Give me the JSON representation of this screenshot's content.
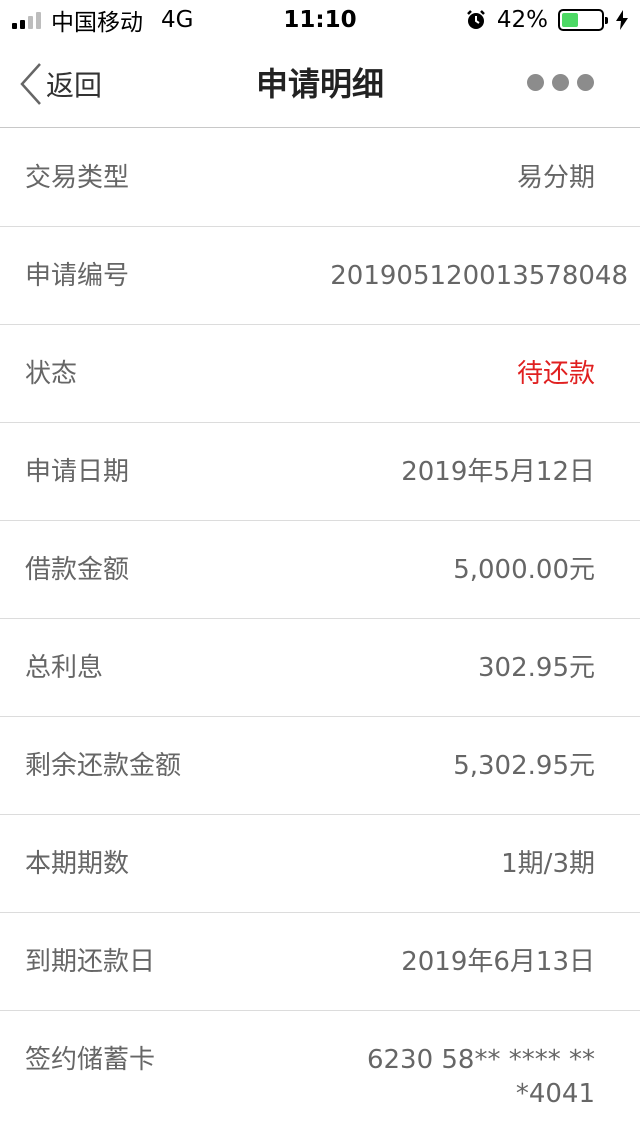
{
  "status_bar": {
    "carrier": "中国移动",
    "network": "4G",
    "time": "11:10",
    "battery_percent": "42%",
    "battery_level": 0.42,
    "battery_color": "#4cd964"
  },
  "nav": {
    "back_label": "返回",
    "title": "申请明细"
  },
  "details": [
    {
      "label": "交易类型",
      "value": "易分期"
    },
    {
      "label": "申请编号",
      "value": "201905120013578048"
    },
    {
      "label": "状态",
      "value": "待还款",
      "color": "#e02020"
    },
    {
      "label": "申请日期",
      "value": "2019年5月12日"
    },
    {
      "label": "借款金额",
      "value": "5,000.00元"
    },
    {
      "label": "总利息",
      "value": "302.95元"
    },
    {
      "label": "剩余还款金额",
      "value": "5,302.95元"
    },
    {
      "label": "本期期数",
      "value": "1期/3期"
    },
    {
      "label": "到期还款日",
      "value": "2019年6月13日"
    },
    {
      "label": "签约储蓄卡",
      "value": "6230 58** **** ***4041"
    }
  ],
  "icons": {
    "signal": "signal-icon",
    "alarm": "alarm-icon",
    "battery": "battery-icon",
    "charging": "charging-bolt-icon",
    "back": "chevron-left-icon",
    "more": "more-dots-icon"
  }
}
